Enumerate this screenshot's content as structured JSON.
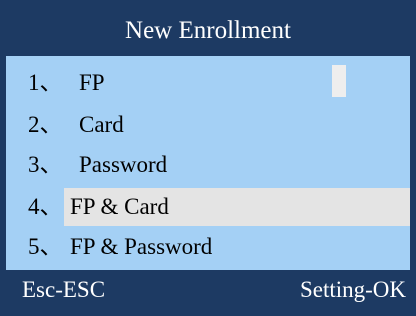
{
  "header": {
    "title": "New Enrollment"
  },
  "menu": {
    "items": [
      {
        "number": "1、",
        "label": "FP"
      },
      {
        "number": "2、",
        "label": "Card"
      },
      {
        "number": "3、",
        "label": "Password"
      },
      {
        "number": "4、",
        "label": "FP & Card"
      },
      {
        "number": "5、",
        "label": "FP & Password"
      }
    ],
    "selected_index": 4
  },
  "footer": {
    "left_label": "Esc-ESC",
    "right_label": "Setting-OK"
  },
  "colors": {
    "frame": "#1d3a63",
    "menu_background": "#a4d0f5",
    "highlight": "#e4e4e4",
    "text_dark": "#000000",
    "text_light": "#ffffff"
  }
}
